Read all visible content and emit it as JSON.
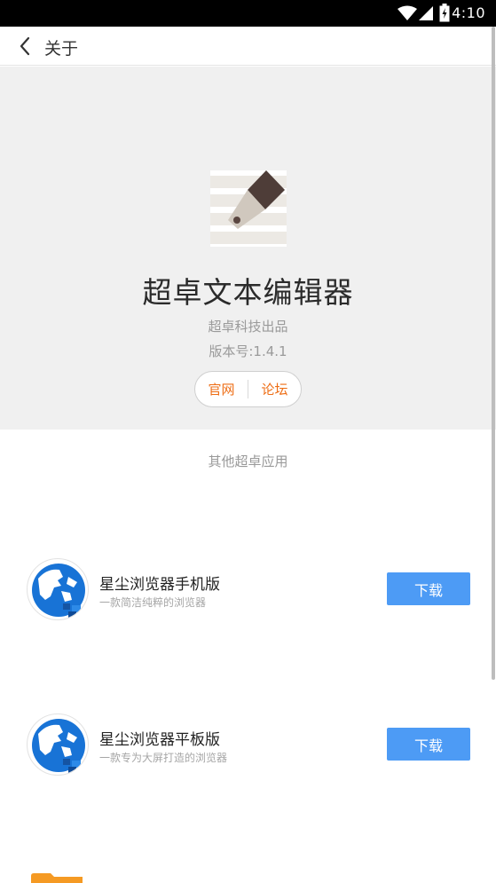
{
  "status_bar": {
    "time": "4:10",
    "icons": [
      "wifi-icon",
      "cell-signal-icon",
      "battery-icon"
    ]
  },
  "header": {
    "back_icon": "chevron-left-icon",
    "title": "关于"
  },
  "app": {
    "name": "超卓文本编辑器",
    "publisher": "超卓科技出品",
    "version": "版本号:1.4.1",
    "links": {
      "website": "官网",
      "forum": "论坛"
    },
    "link_color": "#ee6e16"
  },
  "other_apps": {
    "title": "其他超卓应用",
    "items": [
      {
        "name": "星尘浏览器手机版",
        "description": "一款简洁纯粹的浏览器",
        "button": "下载"
      },
      {
        "name": "星尘浏览器平板版",
        "description": "一款专为大屏打造的浏览器",
        "button": "下载"
      }
    ]
  },
  "colors": {
    "accent": "#4d9bf5",
    "hero_background": "#f0f0f0"
  }
}
